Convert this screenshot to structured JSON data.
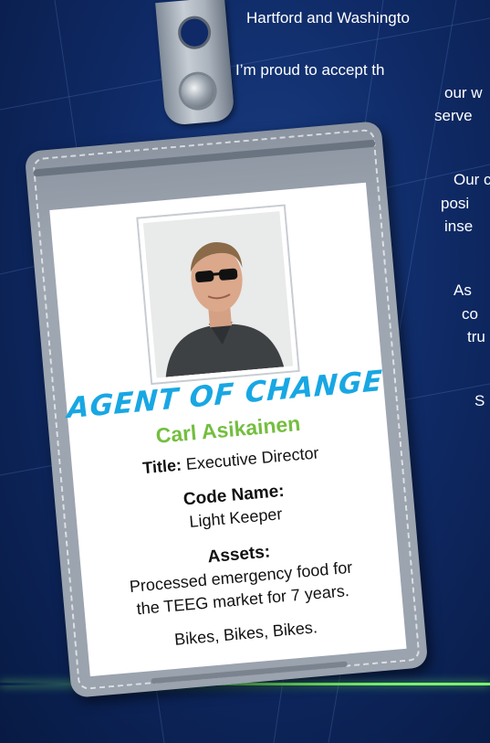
{
  "background_text": {
    "line1": "Hartford and Washingto",
    "line2": "I’m proud to accept th",
    "line3": "our w",
    "line4": "serve",
    "line5": "Our c",
    "line6": "posi",
    "line7": "inse",
    "line8": "As",
    "line9": "co",
    "line10": "tru",
    "line11": "S"
  },
  "badge": {
    "heading": "AGENT OF CHANGE",
    "name": "Carl Asikainen",
    "title_label": "Title:",
    "title_value": "Executive Director",
    "code_name_label": "Code Name:",
    "code_name_value": "Light Keeper",
    "assets_label": "Assets:",
    "assets_line1": "Processed emergency food for",
    "assets_line2": "the TEEG market for 7 years.",
    "assets_line3": "Bikes, Bikes, Bikes."
  },
  "colors": {
    "background": "#0f2a66",
    "heading": "#18a7e3",
    "name": "#74be3f",
    "accent_line": "#7bff6d",
    "holder": "#9aa3ae"
  }
}
